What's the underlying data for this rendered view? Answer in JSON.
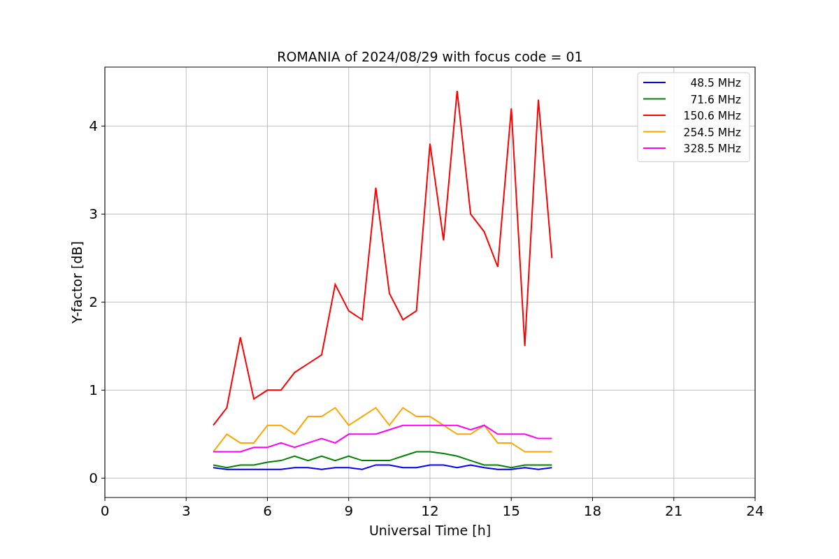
{
  "chart_data": {
    "type": "line",
    "title": "ROMANIA of 2024/08/29 with focus code = 01",
    "xlabel": "Universal Time [h]",
    "ylabel": "Y-factor [dB]",
    "x": [
      4,
      4.5,
      5,
      5.5,
      6,
      6.5,
      7,
      7.5,
      8,
      8.5,
      9,
      9.5,
      10,
      10.5,
      11,
      11.5,
      12,
      12.5,
      13,
      13.5,
      14,
      14.5,
      15,
      15.5,
      16,
      16.5
    ],
    "series": [
      {
        "name": "48.5 MHz",
        "color": "#0000ff",
        "values": [
          0.12,
          0.1,
          0.1,
          0.1,
          0.1,
          0.1,
          0.12,
          0.12,
          0.1,
          0.12,
          0.12,
          0.1,
          0.15,
          0.15,
          0.12,
          0.12,
          0.15,
          0.15,
          0.12,
          0.15,
          0.12,
          0.1,
          0.1,
          0.12,
          0.1,
          0.12
        ]
      },
      {
        "name": "71.6 MHz",
        "color": "#008000",
        "values": [
          0.15,
          0.12,
          0.15,
          0.15,
          0.18,
          0.2,
          0.25,
          0.2,
          0.25,
          0.2,
          0.25,
          0.2,
          0.2,
          0.2,
          0.25,
          0.3,
          0.3,
          0.28,
          0.25,
          0.2,
          0.15,
          0.15,
          0.12,
          0.15,
          0.15,
          0.15
        ]
      },
      {
        "name": "150.6 MHz",
        "color": "#ff0000",
        "values": [
          0.6,
          0.8,
          1.6,
          0.9,
          1.0,
          1.0,
          1.2,
          1.3,
          1.4,
          2.2,
          1.9,
          1.8,
          3.3,
          2.1,
          1.8,
          1.9,
          3.8,
          2.7,
          4.4,
          3.0,
          2.8,
          2.4,
          4.2,
          1.5,
          4.3,
          2.5
        ]
      },
      {
        "name": "254.5 MHz",
        "color": "#ffa500",
        "values": [
          0.3,
          0.5,
          0.4,
          0.4,
          0.6,
          0.6,
          0.5,
          0.7,
          0.7,
          0.8,
          0.6,
          0.7,
          0.8,
          0.6,
          0.8,
          0.7,
          0.7,
          0.6,
          0.5,
          0.5,
          0.6,
          0.4,
          0.4,
          0.3,
          0.3,
          0.3
        ]
      },
      {
        "name": "328.5 MHz",
        "color": "#ff00ff",
        "values": [
          0.3,
          0.3,
          0.3,
          0.35,
          0.35,
          0.4,
          0.35,
          0.4,
          0.45,
          0.4,
          0.5,
          0.5,
          0.5,
          0.55,
          0.6,
          0.6,
          0.6,
          0.6,
          0.6,
          0.55,
          0.6,
          0.5,
          0.5,
          0.5,
          0.45,
          0.45
        ]
      }
    ],
    "xlim": [
      0,
      24
    ],
    "ylim": [
      -0.22,
      4.67
    ],
    "xticks": [
      0,
      3,
      6,
      9,
      12,
      15,
      18,
      21,
      24
    ],
    "yticks": [
      0,
      1,
      2,
      3,
      4
    ],
    "grid": true,
    "legend": true
  }
}
